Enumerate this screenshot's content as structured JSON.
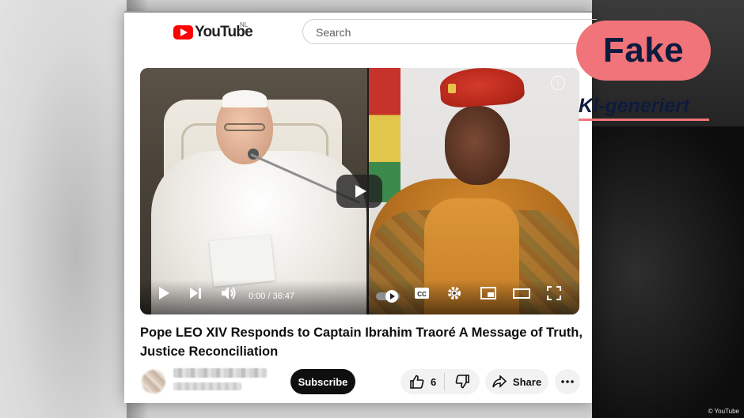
{
  "youtube": {
    "logo_text": "YouTube",
    "region": "NL",
    "search_placeholder": "Search"
  },
  "video": {
    "time_display": "0:00 / 36:47",
    "title": "Pope LEO XIV Responds to Captain Ibrahim Traoré A Message of Truth, Justice Reconciliation"
  },
  "actions": {
    "subscribe_label": "Subscribe",
    "like_count": "6",
    "share_label": "Share"
  },
  "overlay": {
    "fake_label": "Fake",
    "ki_label": "KI-generiert",
    "credit": "© YouTube",
    "accent_color": "#f07479",
    "text_color": "#0d1b3e"
  },
  "icons": [
    "play-icon",
    "next-icon",
    "volume-icon",
    "autoplay-toggle",
    "cc-icon",
    "settings-icon",
    "miniplayer-icon",
    "theater-icon",
    "fullscreen-icon",
    "like-icon",
    "dislike-icon",
    "share-icon",
    "more-icon",
    "info-icon"
  ]
}
